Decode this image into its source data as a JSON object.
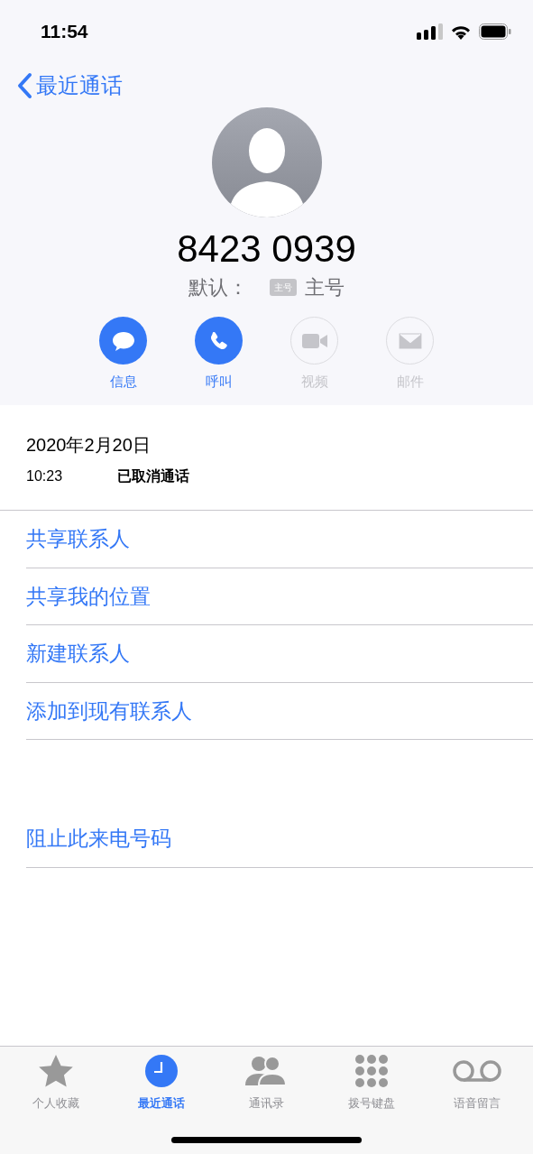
{
  "status_bar": {
    "time": "11:54"
  },
  "nav": {
    "back_label": "最近通话"
  },
  "contact": {
    "number": "8423 0939",
    "default_label": "默认：",
    "default_tag": "主号",
    "default_value": "主号"
  },
  "actions": [
    {
      "kind": "message",
      "label": "信息",
      "disabled": false
    },
    {
      "kind": "call",
      "label": "呼叫",
      "disabled": false
    },
    {
      "kind": "video",
      "label": "视频",
      "disabled": true
    },
    {
      "kind": "mail",
      "label": "邮件",
      "disabled": true
    }
  ],
  "call_log": {
    "date": "2020年2月20日",
    "entries": [
      {
        "time": "10:23",
        "status": "已取消通话"
      }
    ]
  },
  "options": [
    {
      "label": "共享联系人"
    },
    {
      "label": "共享我的位置"
    },
    {
      "label": "新建联系人"
    },
    {
      "label": "添加到现有联系人"
    }
  ],
  "block_option": {
    "label": "阻止此来电号码"
  },
  "tab_bar": [
    {
      "kind": "favorites",
      "label": "个人收藏",
      "selected": false
    },
    {
      "kind": "recents",
      "label": "最近通话",
      "selected": true
    },
    {
      "kind": "contacts",
      "label": "通讯录",
      "selected": false
    },
    {
      "kind": "keypad",
      "label": "拨号键盘",
      "selected": false
    },
    {
      "kind": "voicemail",
      "label": "语音留言",
      "selected": false
    }
  ]
}
